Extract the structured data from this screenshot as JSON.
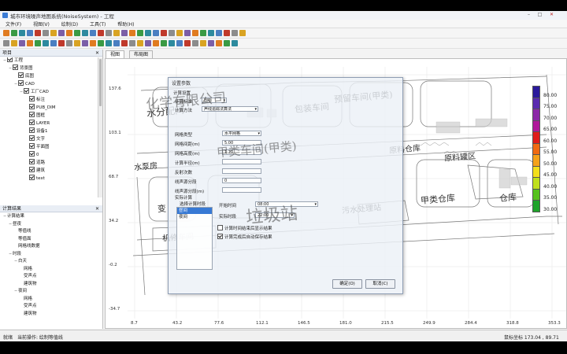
{
  "window": {
    "title": "城市环境噪声地图系统(NoiseSystem) - 工程"
  },
  "menu": [
    "文件(F)",
    "视图(V)",
    "绘制(D)",
    "工具(T)",
    "帮助(H)"
  ],
  "project_panel": {
    "title": "项目",
    "items": [
      {
        "label": "工程",
        "level": 0,
        "expand": "−",
        "checkbox": true
      },
      {
        "label": "背景图",
        "level": 1,
        "expand": "−",
        "checkbox": true
      },
      {
        "label": "底图",
        "level": 2,
        "expand": "",
        "checkbox": true
      },
      {
        "label": "CAD",
        "level": 2,
        "expand": "−",
        "checkbox": true
      },
      {
        "label": "工厂CAD",
        "level": 3,
        "expand": "−",
        "checkbox": true
      },
      {
        "label": "标注",
        "level": 4,
        "expand": "",
        "checkbox": true
      },
      {
        "label": "PUB_DIM",
        "level": 4,
        "expand": "",
        "checkbox": true
      },
      {
        "label": "图框",
        "level": 4,
        "expand": "",
        "checkbox": true
      },
      {
        "label": "LAYER",
        "level": 4,
        "expand": "",
        "checkbox": true
      },
      {
        "label": "设备1",
        "level": 4,
        "expand": "",
        "checkbox": true
      },
      {
        "label": "文字",
        "level": 4,
        "expand": "",
        "checkbox": true
      },
      {
        "label": "平面图",
        "level": 4,
        "expand": "",
        "checkbox": true
      },
      {
        "label": "0",
        "level": 4,
        "expand": "",
        "checkbox": true
      },
      {
        "label": "道路",
        "level": 4,
        "expand": "",
        "checkbox": true
      },
      {
        "label": "建筑",
        "level": 4,
        "expand": "",
        "checkbox": true
      },
      {
        "label": "text",
        "level": 4,
        "expand": "",
        "checkbox": true
      }
    ]
  },
  "results_panel": {
    "title": "计算结果",
    "items": [
      {
        "label": "计算结果",
        "level": 0,
        "expand": "−"
      },
      {
        "label": "昼夜",
        "level": 1,
        "expand": "−"
      },
      {
        "label": "等值线",
        "level": 2,
        "expand": ""
      },
      {
        "label": "等值面",
        "level": 2,
        "expand": ""
      },
      {
        "label": "网格线数据",
        "level": 2,
        "expand": ""
      },
      {
        "label": "时段",
        "level": 1,
        "expand": "−"
      },
      {
        "label": "白天",
        "level": 2,
        "expand": "−"
      },
      {
        "label": "网格",
        "level": 3,
        "expand": ""
      },
      {
        "label": "受声点",
        "level": 3,
        "expand": ""
      },
      {
        "label": "建筑物",
        "level": 3,
        "expand": ""
      },
      {
        "label": "夜间",
        "level": 2,
        "expand": "−"
      },
      {
        "label": "网格",
        "level": 3,
        "expand": ""
      },
      {
        "label": "受声点",
        "level": 3,
        "expand": ""
      },
      {
        "label": "建筑物",
        "level": 3,
        "expand": ""
      }
    ]
  },
  "tabs": [
    "视图",
    "布局图"
  ],
  "axes": {
    "y_ticks": [
      "137.6",
      "103.1",
      "68.7",
      "34.2",
      "-0.2",
      "-34.7"
    ],
    "x_ticks": [
      "8.7",
      "43.2",
      "77.6",
      "112.1",
      "146.5",
      "181.0",
      "215.5",
      "249.9",
      "284.4",
      "318.8",
      "353.3"
    ]
  },
  "legend": {
    "entries": [
      {
        "label": "80.00",
        "color": "#2b1a9c"
      },
      {
        "label": "75.00",
        "color": "#5a2bb0"
      },
      {
        "label": "70.00",
        "color": "#8c28a8"
      },
      {
        "label": "65.00",
        "color": "#b0179a"
      },
      {
        "label": "60.00",
        "color": "#e01b1b"
      },
      {
        "label": "55.00",
        "color": "#f06a12"
      },
      {
        "label": "50.00",
        "color": "#f5a21a"
      },
      {
        "label": "45.00",
        "color": "#f3df1c"
      },
      {
        "label": "40.00",
        "color": "#bfe01c"
      },
      {
        "label": "35.00",
        "color": "#56c21d"
      },
      {
        "label": "30.00",
        "color": "#1ea32a"
      }
    ]
  },
  "dialog": {
    "title": "设置参数",
    "group_calc": "计算设置",
    "calc_standard_label": "计算标准",
    "calc_standard_value": "国标",
    "calc_method_label": "计算方法",
    "calc_method_value": "声线追踪法算法",
    "grid_type_label": "网格类型",
    "grid_type_value": "水平网格",
    "field_labels": [
      "网格间距(m)",
      "网格高度(m)",
      "计算半径(m)",
      "反射次数",
      "线声源分段",
      "线声源分段(m)"
    ],
    "field_values": [
      "5.00",
      "1.20",
      "",
      "",
      "0",
      ""
    ],
    "extra_label": "实际计算",
    "list_header": "选择计算时段",
    "list_items": [
      "昼间",
      "夜间"
    ],
    "time_label_1": "开始时间",
    "time_label_2": "实际时段",
    "time_value_1": "08:00",
    "time_value_2": "22:00",
    "checkbox_label_1": "计算时间结束后显示结果",
    "checkbox_label_2": "计算完成后自动保存结果",
    "ok_button": "确定(O)",
    "cancel_button": "取消(C)"
  },
  "map_labels": [
    "水分配间",
    "水泵房",
    "变",
    "机修车间",
    "仓库",
    "预留车间(甲类)",
    "包装车间",
    "甲类仓库",
    "污水处理站",
    "原料仓库",
    "原料罐区"
  ],
  "watermark": {
    "line1": "化学有限公司",
    "line2": "甲类车间(甲类)",
    "line3": "垃圾站"
  },
  "statusbar": {
    "left": "就绪",
    "middle": "当前操作: 绘制等值线",
    "right": "鼠标坐标 173.04 , 89.71"
  }
}
